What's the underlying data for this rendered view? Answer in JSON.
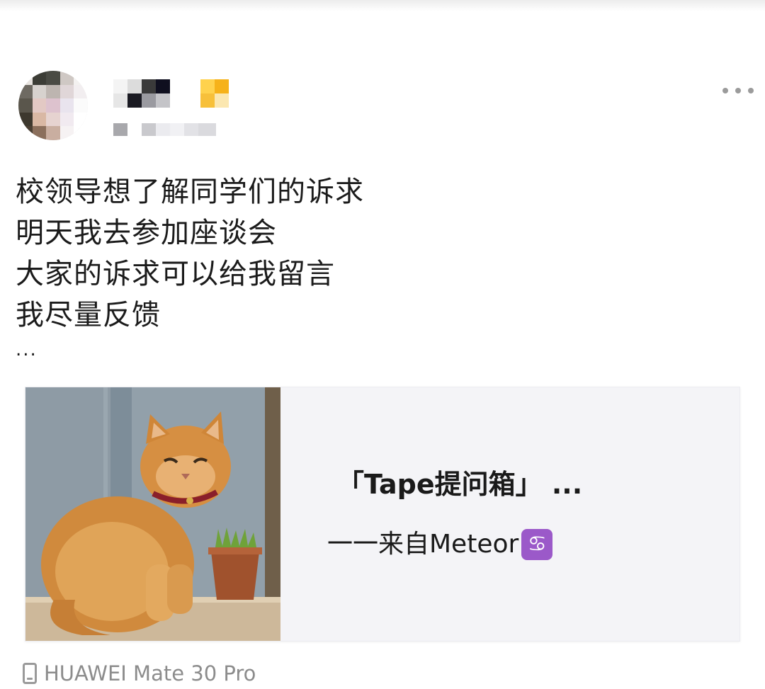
{
  "post": {
    "lines": [
      "校领导想了解同学们的诉求",
      "明天我去参加座谈会",
      "大家的诉求可以给我留言",
      "我尽量反馈"
    ],
    "ellipsis": "..."
  },
  "link_card": {
    "title": "「Tape提问箱」 ...",
    "subtitle": "一一来自Meteor",
    "emoji": "♋"
  },
  "device": {
    "name": "HUAWEI Mate 30 Pro",
    "icon": "phone-icon"
  },
  "header": {
    "more_icon": "more-dots-icon"
  },
  "colors": {
    "text": "#1b1b1b",
    "muted": "#8c8c8c",
    "card_bg": "#f4f4f7",
    "zodiac_bg": "#9b59c9"
  }
}
